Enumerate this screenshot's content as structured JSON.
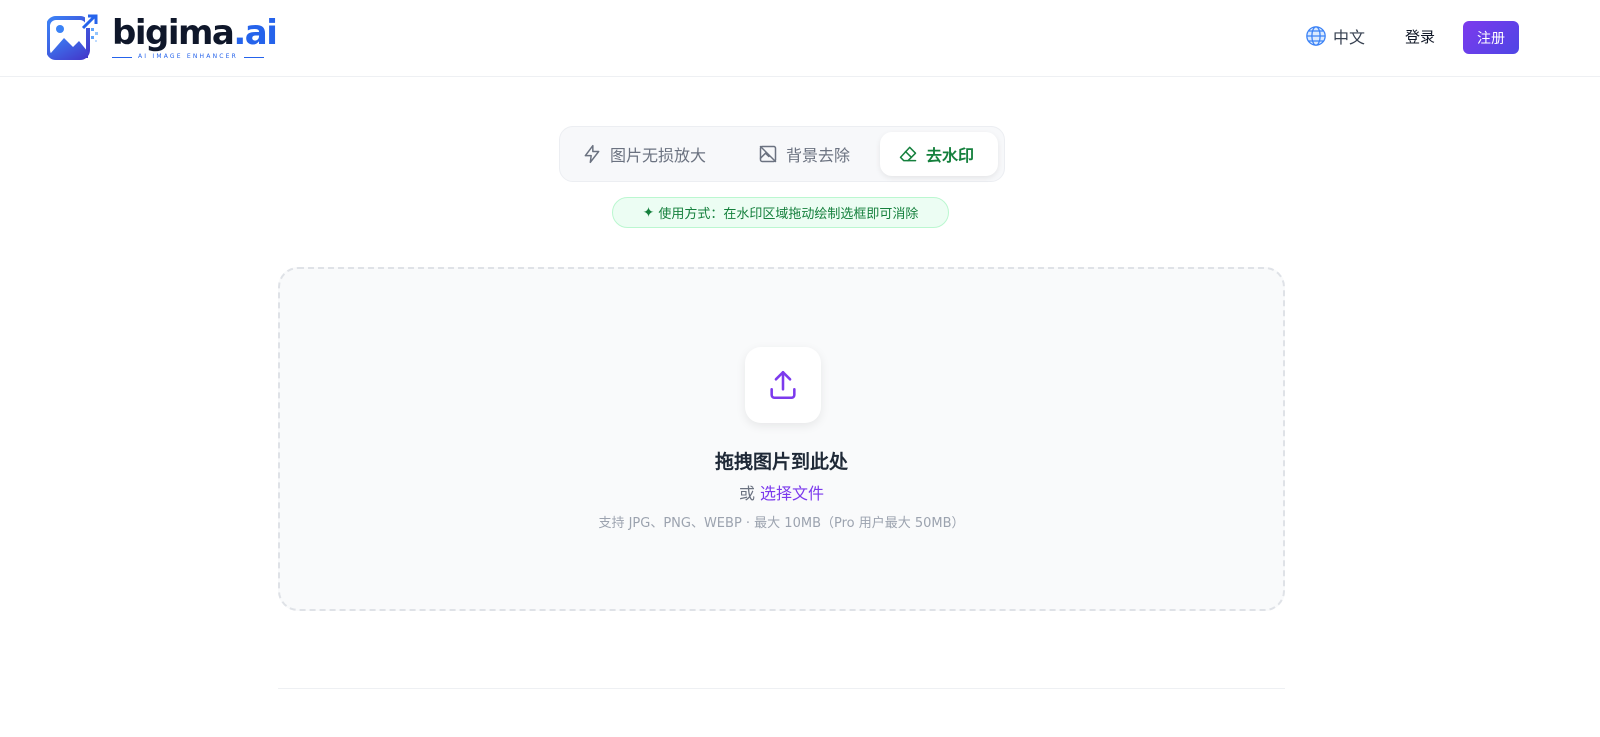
{
  "brand": {
    "name_main": "bigima",
    "name_suffix": ".ai",
    "tagline": "AI IMAGE ENHANCER",
    "logo_icon": "image-enhance-logo-icon",
    "accent": "#2563eb"
  },
  "header": {
    "language_icon": "globe-icon",
    "language_label": "中文",
    "login_label": "登录",
    "signup_label": "注册",
    "signup_color": "#6d28d9"
  },
  "tabs": [
    {
      "label": "图片无损放大",
      "icon": "lightning-icon",
      "active": false
    },
    {
      "label": "背景去除",
      "icon": "no-image-icon",
      "active": true
    },
    {
      "label": "去水印",
      "icon": "eraser-icon",
      "active": true
    }
  ],
  "hint": {
    "icon": "sparkle-icon",
    "text": "使用方式：在水印区域拖动绘制选框即可消除"
  },
  "dropzone": {
    "icon": "upload-icon",
    "title": "拖拽图片到此处",
    "or_text": "或",
    "choose_label": "选择文件",
    "note": "支持 JPG、PNG、WEBP · 最大 10MB（Pro 用户最大 50MB）",
    "accent": "#7c3aed"
  }
}
